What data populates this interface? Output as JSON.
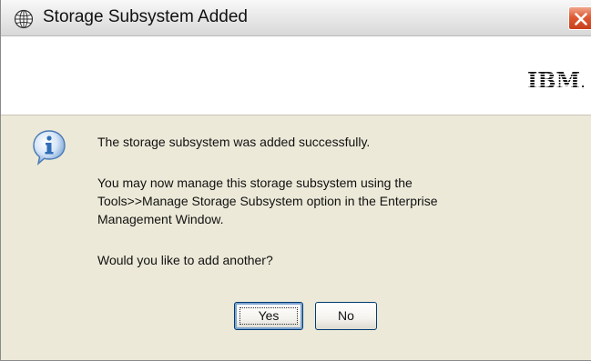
{
  "window": {
    "title": "Storage Subsystem Added",
    "title_icon": "globe-icon",
    "close_icon": "close-icon"
  },
  "banner": {
    "logo_text": "IBM."
  },
  "dialog": {
    "icon": "info-icon",
    "message_line1": "The storage subsystem was added successfully.",
    "message_line2": "You may now manage this storage subsystem using the",
    "message_line3": "Tools>>Manage Storage Subsystem option in the Enterprise",
    "message_line4": "Management Window.",
    "question": "Would you like to add another?"
  },
  "buttons": {
    "yes_label": "Yes",
    "no_label": "No"
  },
  "colors": {
    "close_button": "#df5a34",
    "info_icon": "#2f6fb7",
    "dialog_background": "#ece9d8"
  }
}
